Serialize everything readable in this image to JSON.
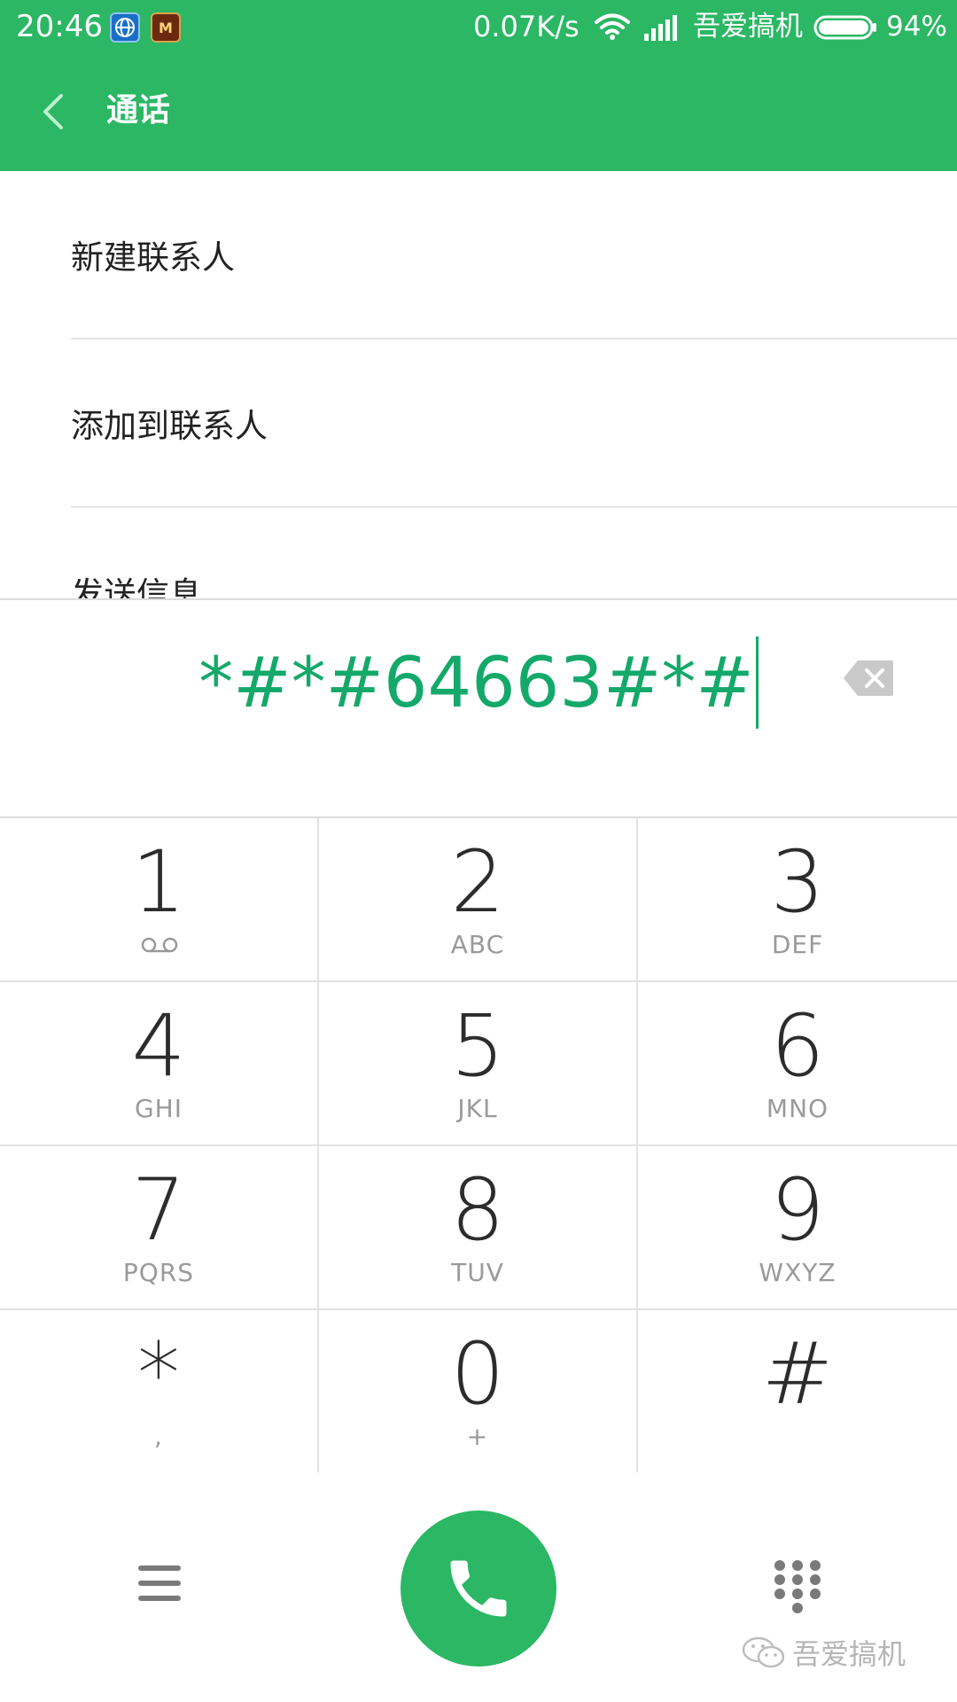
{
  "status_bar": {
    "time": "20:46",
    "network_speed": "0.07K/s",
    "carrier": "吾爱搞机",
    "battery": "94%",
    "app_icon_2_text": "M"
  },
  "header": {
    "title": "通话",
    "back_icon": "chevron-left-icon",
    "color": "#2bb764"
  },
  "options": [
    {
      "label": "新建联系人"
    },
    {
      "label": "添加到联系人"
    },
    {
      "label": "发送信息"
    }
  ],
  "dialer": {
    "number": "*#*#64663#*#",
    "text_color": "#14a96a"
  },
  "keypad": {
    "keys": [
      {
        "digit": "1",
        "sub": ""
      },
      {
        "digit": "2",
        "sub": "ABC"
      },
      {
        "digit": "3",
        "sub": "DEF"
      },
      {
        "digit": "4",
        "sub": "GHI"
      },
      {
        "digit": "5",
        "sub": "JKL"
      },
      {
        "digit": "6",
        "sub": "MNO"
      },
      {
        "digit": "7",
        "sub": "PQRS"
      },
      {
        "digit": "8",
        "sub": "TUV"
      },
      {
        "digit": "9",
        "sub": "WXYZ"
      },
      {
        "digit": "*",
        "sub": ","
      },
      {
        "digit": "0",
        "sub": "+"
      },
      {
        "digit": "#",
        "sub": ""
      }
    ]
  },
  "bottom_bar": {
    "menu_icon": "menu-icon",
    "call_icon": "phone-icon",
    "dialpad_icon": "dialpad-icon",
    "watermark": "吾爱搞机"
  }
}
